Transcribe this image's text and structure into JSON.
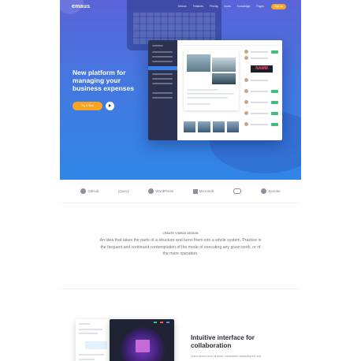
{
  "header": {
    "logo": "emaus",
    "nav": [
      "Demos",
      "Features",
      "Pricing",
      "Icons",
      "Knowledge",
      "Pages"
    ],
    "signup": "Sign up"
  },
  "hero": {
    "headline": "New platform for managing your business expenses",
    "cta": "Try it Now",
    "mockup_badge": "NAMM"
  },
  "logos": [
    "GitHub",
    "jQuery",
    "WordPress",
    "Microsoft",
    "Joomla!"
  ],
  "about": {
    "eyebrow": "CREATE VISIBLE DESIGN",
    "text": "An idea that takes the parts of a structure and turns them into a whole system. Practice is the frequent and continued contemplation of the mode of executing any given work, or of the mere operation."
  },
  "feature": {
    "title": "Intuitive interface for collaboration",
    "subtitle": "Lorem ipsum dolor sit amet, consectetur adipiscing elit, sed"
  },
  "colors": {
    "hero_top": "#5a63d8",
    "hero_bottom": "#2f86e6",
    "accent": "#f6a623"
  }
}
